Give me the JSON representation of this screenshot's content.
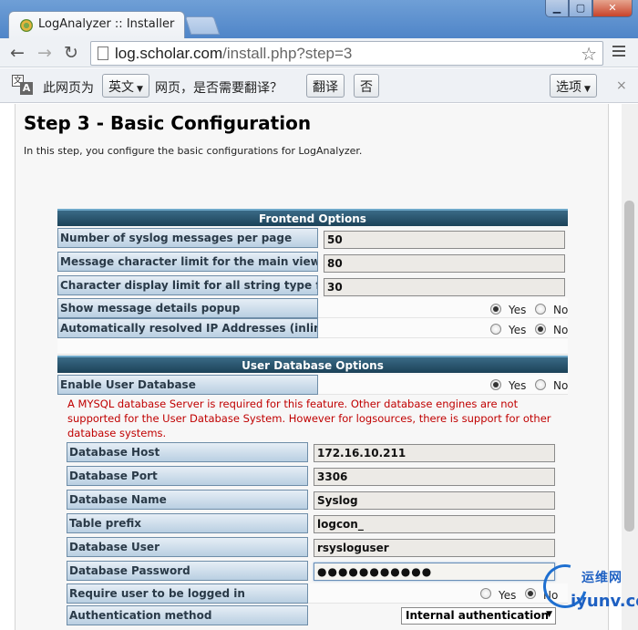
{
  "browser": {
    "tab_title": "LogAnalyzer :: Installer",
    "url_host": "log.scholar.com",
    "url_path": "/install.php?step=3"
  },
  "translate_bar": {
    "prefix": "此网页为",
    "language": "英文",
    "suffix": "网页，是否需要翻译？",
    "translate_button": "翻译",
    "no_button": "否",
    "options_button": "选项",
    "close_glyph": "×"
  },
  "page": {
    "title": "Step 3 - Basic Configuration",
    "description": "In this step, you configure the basic configurations for LogAnalyzer.",
    "frontend": {
      "header": "Frontend Options",
      "rows": [
        {
          "label": "Number of syslog messages per page",
          "value": "50"
        },
        {
          "label": "Message character limit for the main view",
          "value": "80"
        },
        {
          "label": "Character display limit for all string type fields",
          "value": "30"
        }
      ],
      "popup_label": "Show message details popup",
      "resolve_label": "Automatically resolved IP Addresses (inline)"
    },
    "yes": "Yes",
    "no": "No",
    "userdb": {
      "header": "User Database Options",
      "enable_label": "Enable User Database",
      "warning": "A MYSQL database Server is required for this feature. Other database engines are not supported for the User Database System. However for logsources, there is support for other database systems.",
      "rows": [
        {
          "label": "Database Host",
          "value": "172.16.10.211"
        },
        {
          "label": "Database Port",
          "value": "3306"
        },
        {
          "label": "Database Name",
          "value": "Syslog"
        },
        {
          "label": "Table prefix",
          "value": "logcon_"
        },
        {
          "label": "Database User",
          "value": "rsysloguser"
        },
        {
          "label": "Database Password",
          "value": "●●●●●●●●●●●"
        }
      ],
      "login_label": "Require user to be logged in",
      "auth_label": "Authentication method",
      "auth_value": "Internal authentication"
    }
  },
  "watermark": {
    "cn": "运维网",
    "en": "iyunv.com"
  }
}
